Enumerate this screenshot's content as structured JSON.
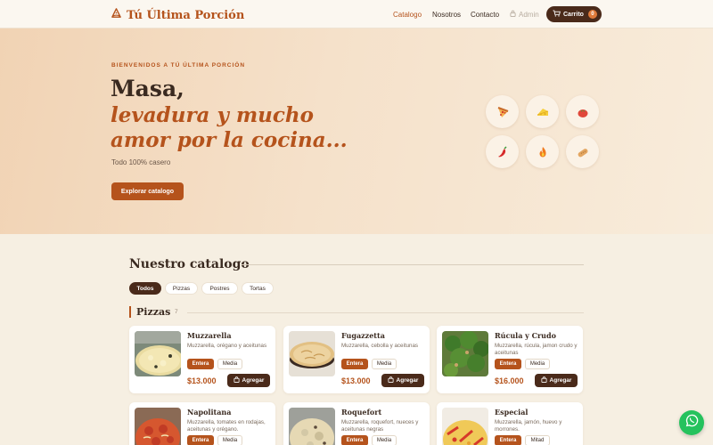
{
  "nav": {
    "brand": "Tú Última Porción",
    "links": [
      "Catalogo",
      "Nosotros",
      "Contacto"
    ],
    "admin": "Admin",
    "cart_label": "Carrito",
    "cart_count": "0"
  },
  "hero": {
    "eyebrow": "BIENVENIDOS A TÚ ÚLTIMA PORCIÓN",
    "title_line1": "Masa,",
    "title_line2": "levadura y mucho",
    "title_line3": "amor por la cocina...",
    "subtitle": "Todo 100% casero",
    "cta": "Explorar catalogo",
    "icons": [
      "pizza-icon",
      "cheese-icon",
      "tomato-icon",
      "chili-icon",
      "fire-icon",
      "bread-icon"
    ]
  },
  "catalog": {
    "title": "Nuestro catalogo",
    "filters": [
      "Todos",
      "Pizzas",
      "Postres",
      "Tortas"
    ],
    "section_title": "Pizzas",
    "section_count": "7",
    "add_label": "Agregar",
    "products": [
      {
        "name": "Muzzarella",
        "desc": "Muzzarella, orégano y aceitunas",
        "opt1": "Entera",
        "opt2": "Media",
        "price": "$13.000"
      },
      {
        "name": "Fugazzetta",
        "desc": "Muzzarella, cebolla y aceitunas",
        "opt1": "Entera",
        "opt2": "Media",
        "price": "$13.000"
      },
      {
        "name": "Rúcula y Crudo",
        "desc": "Muzzarella, rúcula, jamon crudo y aceitunas",
        "opt1": "Entera",
        "opt2": "Media",
        "price": "$16.000"
      },
      {
        "name": "Napolitana",
        "desc": "Muzzarella, tomates en rodajas, aceitunas y orégano.",
        "opt1": "Entera",
        "opt2": "Media"
      },
      {
        "name": "Roquefort",
        "desc": "Muzzarella, roquefort, nueces y aceitunas negras",
        "opt1": "Entera",
        "opt2": "Media"
      },
      {
        "name": "Especial",
        "desc": "Muzzarella, jamón, huevo y morrones.",
        "opt1": "Entera",
        "opt2": "Mitad"
      }
    ]
  },
  "colors": {
    "accent": "#b5531c",
    "dark": "#4a2a1a",
    "whatsapp": "#25c25d"
  }
}
